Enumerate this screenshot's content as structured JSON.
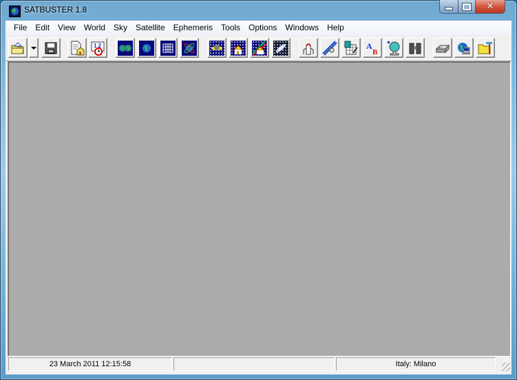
{
  "window": {
    "title": "SATBUSTER 1.8",
    "app_icon": "globe-icon",
    "controls": {
      "minimize": "minimize",
      "maximize": "maximize",
      "close": "close"
    }
  },
  "menubar": {
    "items": [
      {
        "label": "File"
      },
      {
        "label": "Edit"
      },
      {
        "label": "View"
      },
      {
        "label": "World"
      },
      {
        "label": "Sky"
      },
      {
        "label": "Satellite"
      },
      {
        "label": "Ephemeris"
      },
      {
        "label": "Tools"
      },
      {
        "label": "Options"
      },
      {
        "label": "Windows"
      },
      {
        "label": "Help"
      }
    ]
  },
  "toolbar": {
    "buttons": [
      {
        "icon": "open-folder-icon",
        "tooltip": "Open"
      },
      {
        "icon": "dropdown-arrow-icon",
        "tooltip": "Open recent"
      },
      {
        "icon": "floppy-disk-icon",
        "tooltip": "Save"
      },
      {
        "icon": "document-home-icon",
        "tooltip": "Observer location"
      },
      {
        "icon": "calendar-clock-icon",
        "tooltip": "Date and time"
      },
      {
        "icon": "world-map-icon",
        "tooltip": "World map"
      },
      {
        "icon": "globe-icon",
        "tooltip": "Globe"
      },
      {
        "icon": "grid-icon",
        "tooltip": "Grid"
      },
      {
        "icon": "orbit-globe-icon",
        "tooltip": "Orbit"
      },
      {
        "icon": "planet-sky-icon",
        "tooltip": "Sky planet"
      },
      {
        "icon": "house-sky-icon",
        "tooltip": "Local sky"
      },
      {
        "icon": "house-sky-tracks-icon",
        "tooltip": "Sky tracks"
      },
      {
        "icon": "galaxy-icon",
        "tooltip": "Deep sky"
      },
      {
        "icon": "space-shuttle-icon",
        "tooltip": "Shuttle"
      },
      {
        "icon": "satellite-icon",
        "tooltip": "Satellite"
      },
      {
        "icon": "calculator-sheet-icon",
        "tooltip": "Ephemeris table"
      },
      {
        "icon": "font-ab-icon",
        "tooltip": "Fonts"
      },
      {
        "icon": "dish-antenna-icon",
        "tooltip": "Antenna"
      },
      {
        "icon": "binoculars-icon",
        "tooltip": "Observe"
      },
      {
        "icon": "printer-icon",
        "tooltip": "Print"
      },
      {
        "icon": "internet-computer-icon",
        "tooltip": "Internet update"
      },
      {
        "icon": "folder-tools-icon",
        "tooltip": "Tools folder"
      }
    ]
  },
  "statusbar": {
    "datetime": "23 March 2011  12:15:58",
    "middle": "",
    "location": "Italy: Milano"
  },
  "colors": {
    "mdi_background": "#ababab",
    "chrome": "#f0f0f0",
    "icon_navy": "#0a0a7a"
  }
}
